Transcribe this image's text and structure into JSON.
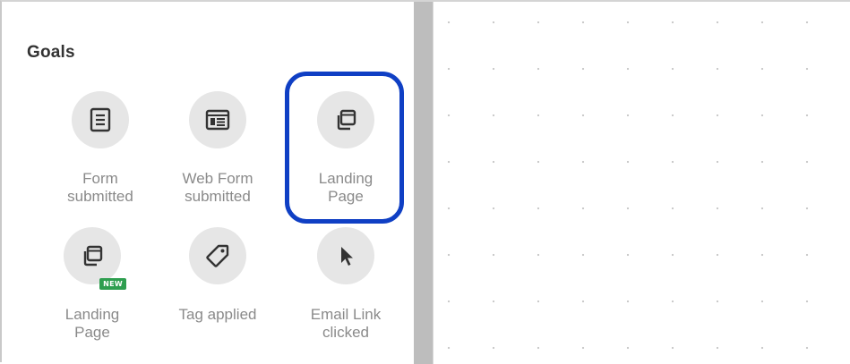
{
  "panel": {
    "title": "Goals"
  },
  "goals": [
    {
      "label": "Form\nsubmitted",
      "icon": "form-icon"
    },
    {
      "label": "Web Form\nsubmitted",
      "icon": "web-form-icon"
    },
    {
      "label": "Landing\nPage",
      "icon": "landing-page-icon",
      "highlighted": true
    },
    {
      "label": "Landing\nPage",
      "icon": "landing-page-icon",
      "badge": "NEW"
    },
    {
      "label": "Tag applied",
      "icon": "tag-icon"
    },
    {
      "label": "Email Link\nclicked",
      "icon": "cursor-icon"
    }
  ],
  "colors": {
    "highlight": "#0f3fc4",
    "badge": "#2e9e4f",
    "icon_circle": "#e6e6e6",
    "label_text": "#8a8a8a"
  }
}
